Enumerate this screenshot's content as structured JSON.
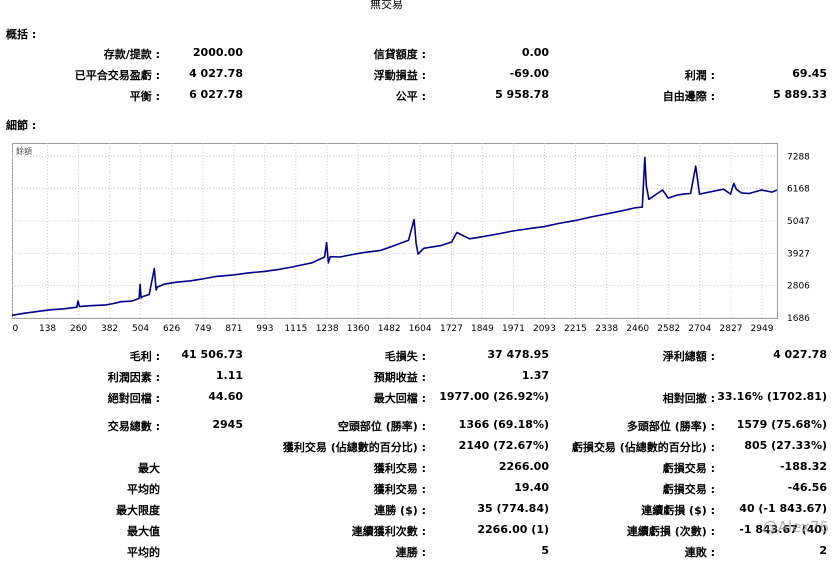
{
  "report_title": "無交易",
  "summary": {
    "heading": "概括 :",
    "deposit_label": "存款/提款 :",
    "deposit_value": "2000.00",
    "credit_label": "信貸額度 :",
    "credit_value": "0.00",
    "closed_pl_label": "已平合交易盈虧 :",
    "closed_pl_value": "4 027.78",
    "floating_pl_label": "浮動損益 :",
    "floating_pl_value": "-69.00",
    "profit_label": "利潤 :",
    "profit_value": "69.45",
    "balance_label": "平衡 :",
    "balance_value": "6 027.78",
    "equity_label": "公平 :",
    "equity_value": "5 958.78",
    "free_margin_label": "自由邊際 :",
    "free_margin_value": "5 889.33"
  },
  "details": {
    "heading": "細節 :",
    "chart_legend": "餘額",
    "gross_profit_label": "毛利 :",
    "gross_profit_value": "41 506.73",
    "gross_loss_label": "毛損失 :",
    "gross_loss_value": "37 478.95",
    "net_profit_label": "淨利總額 :",
    "net_profit_value": "4 027.78",
    "profit_factor_label": "利潤因素 :",
    "profit_factor_value": "1.11",
    "expected_payoff_label": "預期收益 :",
    "expected_payoff_value": "1.37",
    "abs_drawdown_label": "絕對回檔 :",
    "abs_drawdown_value": "44.60",
    "max_drawdown_label": "最大回檔 :",
    "max_drawdown_value": "1977.00 (26.92%)",
    "rel_drawdown_label": "相對回撤 :",
    "rel_drawdown_value": "33.16% (1702.81)",
    "total_trades_label": "交易總數 :",
    "total_trades_value": "2945",
    "short_positions_label": "空頭部位 (勝率) :",
    "short_positions_value": "1366 (69.18%)",
    "long_positions_label": "多頭部位 (勝率) :",
    "long_positions_value": "1579 (75.68%)",
    "profit_trades_label": "獲利交易 (佔總數的百分比) :",
    "profit_trades_value": "2140 (72.67%)",
    "loss_trades_label": "虧損交易 (佔總數的百分比) :",
    "loss_trades_value": "805 (27.33%)",
    "largest_label": "最大",
    "largest_profit_label": "獲利交易 :",
    "largest_profit_value": "2266.00",
    "largest_loss_label": "虧損交易 :",
    "largest_loss_value": "-188.32",
    "average_label": "平均的",
    "avg_profit_label": "獲利交易 :",
    "avg_profit_value": "19.40",
    "avg_loss_label": "虧損交易 :",
    "avg_loss_value": "-46.56",
    "max_limit_label": "最大限度",
    "max_consec_wins_label": "連勝 ($) :",
    "max_consec_wins_value": "35 (774.84)",
    "max_consec_losses_label": "連續虧損 ($) :",
    "max_consec_losses_value": "40 (-1 843.67)",
    "maximal_label": "最大值",
    "max_consec_profit_label": "連續獲利次數 :",
    "max_consec_profit_value": "2266.00 (1)",
    "max_consec_loss_label": "連續虧損 (次數) :",
    "max_consec_loss_value": "-1 843.67 (40)",
    "average2_label": "平均的",
    "avg_consec_wins_label": "連勝 :",
    "avg_consec_wins_value": "5",
    "avg_consec_losses_label": "連敗 :",
    "avg_consec_losses_value": "2"
  },
  "watermark": "@Alex76",
  "colors": {
    "line": "#00008b",
    "grid": "#c8c8c8",
    "frame": "#9a9a9a"
  },
  "chart_data": {
    "type": "line",
    "series": [
      {
        "name": "餘額",
        "x": [
          0,
          40,
          90,
          150,
          200,
          255,
          260,
          265,
          300,
          370,
          400,
          430,
          470,
          500,
          504,
          508,
          512,
          540,
          560,
          567,
          572,
          600,
          650,
          700,
          750,
          800,
          871,
          930,
          993,
          1050,
          1100,
          1180,
          1230,
          1238,
          1245,
          1252,
          1290,
          1330,
          1380,
          1450,
          1500,
          1560,
          1582,
          1590,
          1598,
          1620,
          1690,
          1730,
          1750,
          1800,
          1849,
          1900,
          1971,
          2050,
          2093,
          2150,
          2215,
          2280,
          2338,
          2400,
          2450,
          2480,
          2490,
          2496,
          2506,
          2560,
          2582,
          2620,
          2650,
          2670,
          2690,
          2705,
          2760,
          2800,
          2827,
          2840,
          2850,
          2870,
          2900,
          2949,
          2990,
          3010
        ],
        "values": [
          1780,
          1840,
          1900,
          1970,
          2000,
          2060,
          2280,
          2080,
          2110,
          2140,
          2190,
          2250,
          2270,
          2360,
          2850,
          2380,
          2420,
          2500,
          3400,
          2660,
          2760,
          2860,
          2930,
          2970,
          3040,
          3120,
          3180,
          3250,
          3300,
          3370,
          3450,
          3600,
          3800,
          4300,
          3600,
          3810,
          3800,
          3870,
          3950,
          4030,
          4180,
          4380,
          5100,
          4280,
          3900,
          4100,
          4200,
          4320,
          4650,
          4430,
          4500,
          4580,
          4700,
          4800,
          4850,
          4960,
          5060,
          5190,
          5290,
          5400,
          5500,
          5530,
          7250,
          6250,
          5800,
          6120,
          5840,
          5950,
          5990,
          6000,
          6950,
          5980,
          6080,
          6150,
          5980,
          6350,
          6150,
          6020,
          6000,
          6120,
          6050,
          6120
        ]
      }
    ],
    "x_ticks": [
      0,
      138,
      260,
      382,
      504,
      626,
      749,
      871,
      993,
      1115,
      1238,
      1360,
      1482,
      1604,
      1727,
      1849,
      1971,
      2093,
      2215,
      2338,
      2460,
      2582,
      2704,
      2827,
      2949
    ],
    "y_ticks": [
      1686,
      2806,
      3927,
      5047,
      6168,
      7288
    ],
    "xlim": [
      0,
      3010
    ],
    "ylim": [
      1686,
      7750
    ],
    "grid": true,
    "legend": "top-left"
  }
}
